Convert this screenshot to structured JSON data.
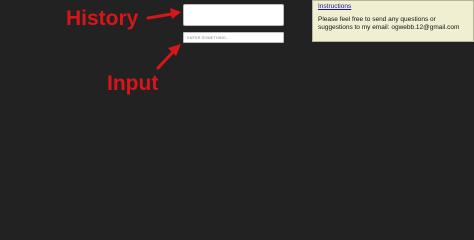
{
  "annotations": {
    "history_label": "History",
    "input_label": "Input",
    "color": "#d8161a"
  },
  "input": {
    "placeholder": "ENTER SOMETHING...",
    "value": ""
  },
  "instructions": {
    "link_label": "Instructions",
    "text": "Please feel free to send any questions or suggestions to my email: ogwebb.12@gmail.com"
  },
  "colors": {
    "background": "#222222",
    "panel": "#f1efd2",
    "link": "#1a0dab"
  }
}
